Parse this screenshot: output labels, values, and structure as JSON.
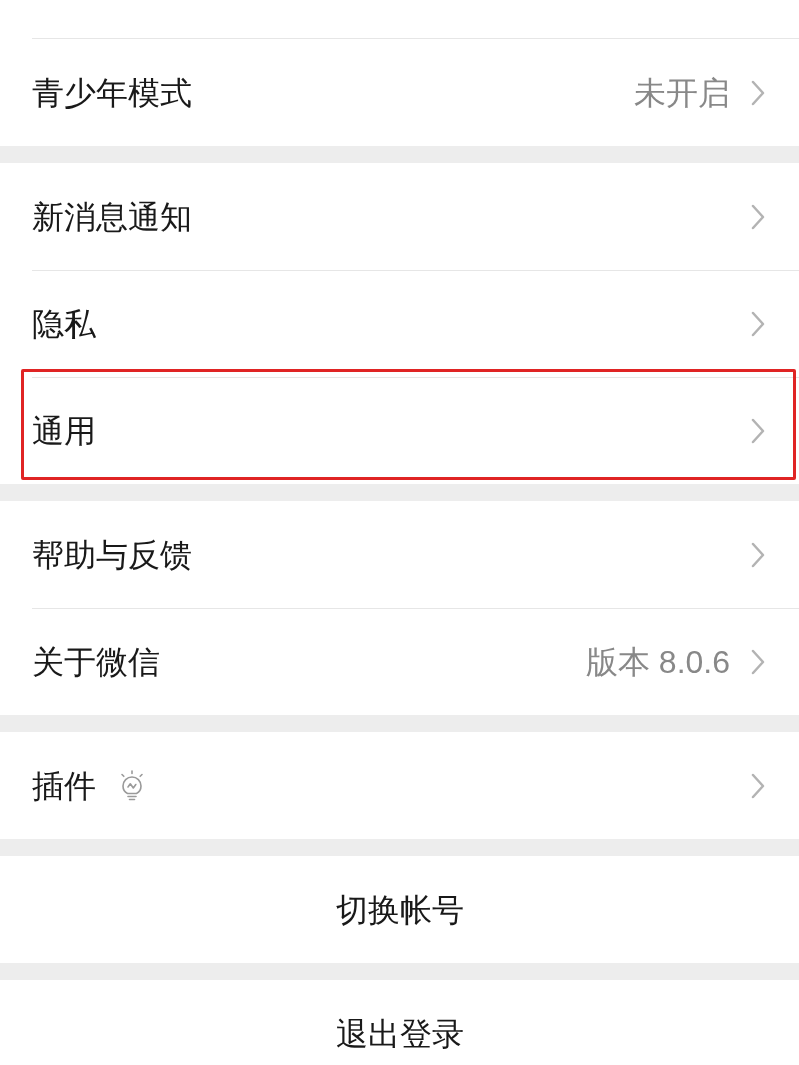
{
  "sections": [
    {
      "items": [
        {
          "kind": "nav",
          "label": "青少年模式",
          "value": "未开启",
          "highlighted": false
        }
      ]
    },
    {
      "items": [
        {
          "kind": "nav",
          "label": "新消息通知",
          "highlighted": false
        },
        {
          "kind": "nav",
          "label": "隐私",
          "highlighted": false
        },
        {
          "kind": "nav",
          "label": "通用",
          "highlighted": true
        }
      ]
    },
    {
      "items": [
        {
          "kind": "nav",
          "label": "帮助与反馈",
          "highlighted": false
        },
        {
          "kind": "nav",
          "label": "关于微信",
          "value": "版本 8.0.6",
          "highlighted": false
        }
      ]
    },
    {
      "items": [
        {
          "kind": "nav",
          "label": "插件",
          "hint_icon": true,
          "highlighted": false
        }
      ]
    },
    {
      "items": [
        {
          "kind": "action",
          "label": "切换帐号"
        }
      ]
    },
    {
      "items": [
        {
          "kind": "action",
          "label": "退出登录"
        }
      ]
    }
  ]
}
